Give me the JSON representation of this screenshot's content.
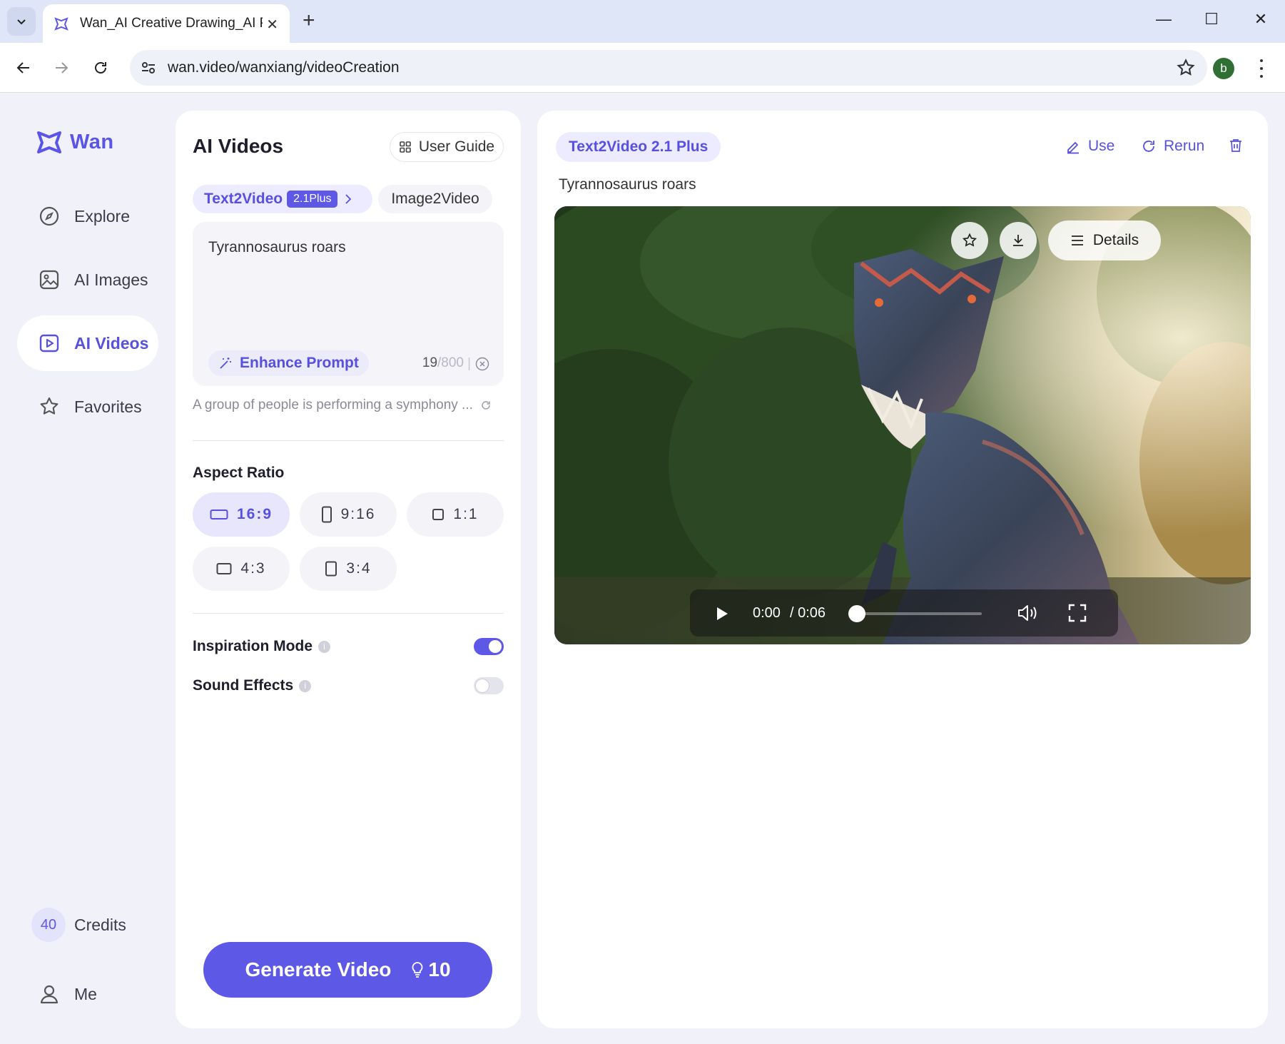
{
  "browser": {
    "tab_title": "Wan_AI Creative Drawing_AI Pa",
    "url": "wan.video/wanxiang/videoCreation",
    "profile_initial": "b"
  },
  "sidebar": {
    "logo": "Wan",
    "items": [
      {
        "label": "Explore",
        "icon": "compass-icon"
      },
      {
        "label": "AI Images",
        "icon": "image-icon"
      },
      {
        "label": "AI Videos",
        "icon": "video-icon",
        "active": true
      },
      {
        "label": "Favorites",
        "icon": "star-icon"
      }
    ],
    "credits_value": "40",
    "credits_label": "Credits",
    "me_label": "Me"
  },
  "panel": {
    "title": "AI Videos",
    "user_guide": "User Guide",
    "mode_active": "Text2Video",
    "mode_badge": "2.1Plus",
    "mode_other": "Image2Video",
    "prompt": "Tyrannosaurus roars",
    "enhance_label": "Enhance Prompt",
    "char_count": "19",
    "char_max": "/800",
    "suggestion": "A group of people is performing a symphony ...",
    "aspect_label": "Aspect Ratio",
    "ratios": [
      "16:9",
      "9:16",
      "1:1",
      "4:3",
      "3:4"
    ],
    "selected_ratio": "16:9",
    "inspiration_label": "Inspiration Mode",
    "inspiration_on": true,
    "sound_label": "Sound Effects",
    "sound_on": false,
    "generate_label": "Generate Video",
    "generate_cost": "10"
  },
  "result": {
    "model": "Text2Video 2.1 Plus",
    "use_label": "Use",
    "rerun_label": "Rerun",
    "prompt": "Tyrannosaurus roars",
    "details_label": "Details",
    "time_current": "0:00",
    "time_total": "/ 0:06",
    "progress": 0
  },
  "colors": {
    "accent": "#5d58e6",
    "accent_soft": "#ecebff",
    "background": "#f1f2f9"
  }
}
